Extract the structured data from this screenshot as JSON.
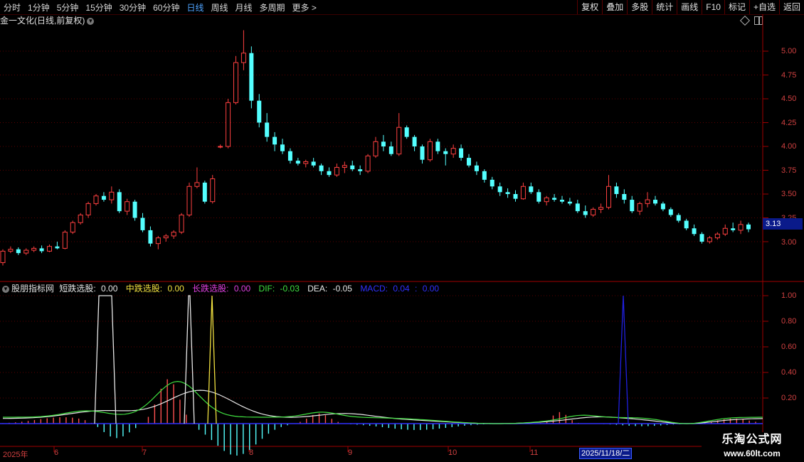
{
  "toolbar": {
    "periods": [
      "分时",
      "1分钟",
      "5分钟",
      "15分钟",
      "30分钟",
      "60分钟",
      "日线",
      "周线",
      "月线",
      "多周期",
      "更多 >"
    ],
    "active_period": "日线",
    "actions": [
      "复权",
      "叠加",
      "多股",
      "统计",
      "画线",
      "F10",
      "标记",
      "+自选",
      "返回"
    ]
  },
  "main_chart": {
    "title": "金一文化(日线,前复权)",
    "price_axis": [
      "5.00",
      "4.75",
      "4.50",
      "4.25",
      "4.00",
      "3.75",
      "3.50",
      "3.25",
      "3.00"
    ],
    "current_price": "3.13"
  },
  "indicator": {
    "name": "股朋指标网",
    "items": [
      {
        "label": "短跌选股:",
        "value": "0.00",
        "color": "#e8e8e8"
      },
      {
        "label": "中跌选股:",
        "value": "0.00",
        "color": "#f0e040"
      },
      {
        "label": "长跌选股:",
        "value": "0.00",
        "color": "#e040e0"
      },
      {
        "label": "DIF:",
        "value": "-0.03",
        "color": "#40e040"
      },
      {
        "label": "DEA:",
        "value": "-0.05",
        "color": "#e8e8e8"
      },
      {
        "label": "MACD:",
        "value": "0.04",
        "color": "#3030ff"
      },
      {
        "label": ":",
        "value": "0.00",
        "color": "#3030ff"
      }
    ],
    "axis": [
      "1.00",
      "0.80",
      "0.60",
      "0.40",
      "0.20"
    ]
  },
  "date_axis": {
    "labels": [
      "2025年",
      "6",
      "7",
      "8",
      "9",
      "10",
      "11"
    ],
    "highlight": "2025/11/18/二"
  },
  "watermark": {
    "line1": "乐淘公式网",
    "line2": "www.60lt.com"
  },
  "chart_data": {
    "type": "candlestick",
    "title": "金一文化(日线,前复权)",
    "ylim": [
      2.75,
      5.25
    ],
    "candles_ohlc": [
      [
        2.78,
        2.92,
        2.75,
        2.9
      ],
      [
        2.9,
        2.95,
        2.88,
        2.92
      ],
      [
        2.92,
        2.94,
        2.86,
        2.88
      ],
      [
        2.88,
        2.93,
        2.86,
        2.91
      ],
      [
        2.91,
        2.95,
        2.89,
        2.93
      ],
      [
        2.93,
        2.96,
        2.88,
        2.9
      ],
      [
        2.9,
        2.97,
        2.89,
        2.95
      ],
      [
        2.95,
        3.0,
        2.92,
        2.93
      ],
      [
        2.93,
        3.12,
        2.92,
        3.1
      ],
      [
        3.1,
        3.22,
        3.08,
        3.2
      ],
      [
        3.2,
        3.3,
        3.18,
        3.28
      ],
      [
        3.28,
        3.42,
        3.25,
        3.4
      ],
      [
        3.4,
        3.5,
        3.38,
        3.48
      ],
      [
        3.48,
        3.52,
        3.42,
        3.44
      ],
      [
        3.44,
        3.58,
        3.4,
        3.52
      ],
      [
        3.52,
        3.55,
        3.3,
        3.32
      ],
      [
        3.32,
        3.45,
        3.28,
        3.42
      ],
      [
        3.42,
        3.44,
        3.22,
        3.25
      ],
      [
        3.25,
        3.3,
        3.1,
        3.12
      ],
      [
        3.12,
        3.16,
        2.95,
        2.98
      ],
      [
        2.98,
        3.06,
        2.92,
        3.04
      ],
      [
        3.04,
        3.08,
        3.0,
        3.06
      ],
      [
        3.06,
        3.12,
        3.03,
        3.1
      ],
      [
        3.1,
        3.3,
        3.08,
        3.28
      ],
      [
        3.28,
        3.62,
        3.26,
        3.58
      ],
      [
        3.58,
        3.78,
        3.56,
        3.62
      ],
      [
        3.62,
        3.64,
        3.4,
        3.42
      ],
      [
        3.42,
        3.7,
        3.4,
        3.66
      ],
      [
        4.0,
        4.02,
        3.98,
        4.0
      ],
      [
        4.0,
        4.5,
        3.98,
        4.46
      ],
      [
        4.46,
        4.95,
        4.44,
        4.88
      ],
      [
        4.88,
        5.22,
        4.8,
        4.98
      ],
      [
        4.98,
        5.05,
        4.4,
        4.48
      ],
      [
        4.48,
        4.55,
        4.2,
        4.25
      ],
      [
        4.25,
        4.35,
        4.05,
        4.1
      ],
      [
        4.1,
        4.15,
        3.95,
        4.02
      ],
      [
        4.02,
        4.08,
        3.92,
        3.95
      ],
      [
        3.95,
        3.98,
        3.82,
        3.85
      ],
      [
        3.85,
        3.88,
        3.8,
        3.82
      ],
      [
        3.82,
        3.86,
        3.78,
        3.84
      ],
      [
        3.84,
        3.88,
        3.78,
        3.8
      ],
      [
        3.8,
        3.82,
        3.7,
        3.74
      ],
      [
        3.74,
        3.78,
        3.68,
        3.7
      ],
      [
        3.7,
        3.82,
        3.68,
        3.78
      ],
      [
        3.78,
        3.84,
        3.72,
        3.8
      ],
      [
        3.8,
        3.85,
        3.74,
        3.76
      ],
      [
        3.76,
        3.8,
        3.7,
        3.74
      ],
      [
        3.74,
        3.92,
        3.72,
        3.9
      ],
      [
        3.9,
        4.1,
        3.88,
        4.05
      ],
      [
        4.05,
        4.12,
        3.95,
        4.0
      ],
      [
        4.0,
        4.05,
        3.9,
        3.92
      ],
      [
        3.92,
        4.35,
        3.9,
        4.2
      ],
      [
        4.2,
        4.22,
        4.08,
        4.1
      ],
      [
        4.1,
        4.12,
        3.95,
        4.0
      ],
      [
        4.0,
        4.02,
        3.82,
        3.86
      ],
      [
        3.86,
        4.08,
        3.84,
        4.05
      ],
      [
        4.05,
        4.08,
        3.92,
        3.95
      ],
      [
        3.95,
        3.98,
        3.8,
        3.92
      ],
      [
        3.92,
        4.02,
        3.88,
        3.98
      ],
      [
        3.98,
        4.02,
        3.85,
        3.88
      ],
      [
        3.88,
        3.92,
        3.78,
        3.8
      ],
      [
        3.8,
        3.84,
        3.7,
        3.74
      ],
      [
        3.74,
        3.76,
        3.62,
        3.65
      ],
      [
        3.65,
        3.68,
        3.55,
        3.58
      ],
      [
        3.58,
        3.62,
        3.48,
        3.52
      ],
      [
        3.52,
        3.56,
        3.46,
        3.5
      ],
      [
        3.5,
        3.54,
        3.42,
        3.45
      ],
      [
        3.45,
        3.62,
        3.44,
        3.58
      ],
      [
        3.58,
        3.62,
        3.5,
        3.52
      ],
      [
        3.52,
        3.55,
        3.4,
        3.42
      ],
      [
        3.42,
        3.48,
        3.38,
        3.46
      ],
      [
        3.46,
        3.5,
        3.42,
        3.44
      ],
      [
        3.44,
        3.48,
        3.4,
        3.42
      ],
      [
        3.42,
        3.46,
        3.38,
        3.4
      ],
      [
        3.4,
        3.44,
        3.3,
        3.32
      ],
      [
        3.32,
        3.38,
        3.25,
        3.28
      ],
      [
        3.28,
        3.36,
        3.26,
        3.34
      ],
      [
        3.34,
        3.4,
        3.3,
        3.36
      ],
      [
        3.36,
        3.7,
        3.34,
        3.58
      ],
      [
        3.58,
        3.62,
        3.46,
        3.5
      ],
      [
        3.5,
        3.55,
        3.4,
        3.44
      ],
      [
        3.44,
        3.48,
        3.3,
        3.32
      ],
      [
        3.32,
        3.42,
        3.28,
        3.4
      ],
      [
        3.4,
        3.52,
        3.36,
        3.44
      ],
      [
        3.44,
        3.48,
        3.38,
        3.4
      ],
      [
        3.4,
        3.42,
        3.32,
        3.34
      ],
      [
        3.34,
        3.36,
        3.26,
        3.28
      ],
      [
        3.28,
        3.3,
        3.2,
        3.22
      ],
      [
        3.22,
        3.24,
        3.12,
        3.14
      ],
      [
        3.14,
        3.18,
        3.06,
        3.08
      ],
      [
        3.08,
        3.1,
        2.98,
        3.0
      ],
      [
        3.0,
        3.06,
        2.98,
        3.04
      ],
      [
        3.04,
        3.1,
        3.02,
        3.08
      ],
      [
        3.08,
        3.18,
        3.06,
        3.14
      ],
      [
        3.14,
        3.2,
        3.1,
        3.12
      ],
      [
        3.12,
        3.22,
        3.08,
        3.18
      ],
      [
        3.18,
        3.2,
        3.1,
        3.13
      ]
    ],
    "short_signal_peaks": [
      0.0,
      1.0,
      1.0,
      0.0
    ],
    "macd_lines": {
      "dif": "green",
      "dea": "white"
    }
  }
}
